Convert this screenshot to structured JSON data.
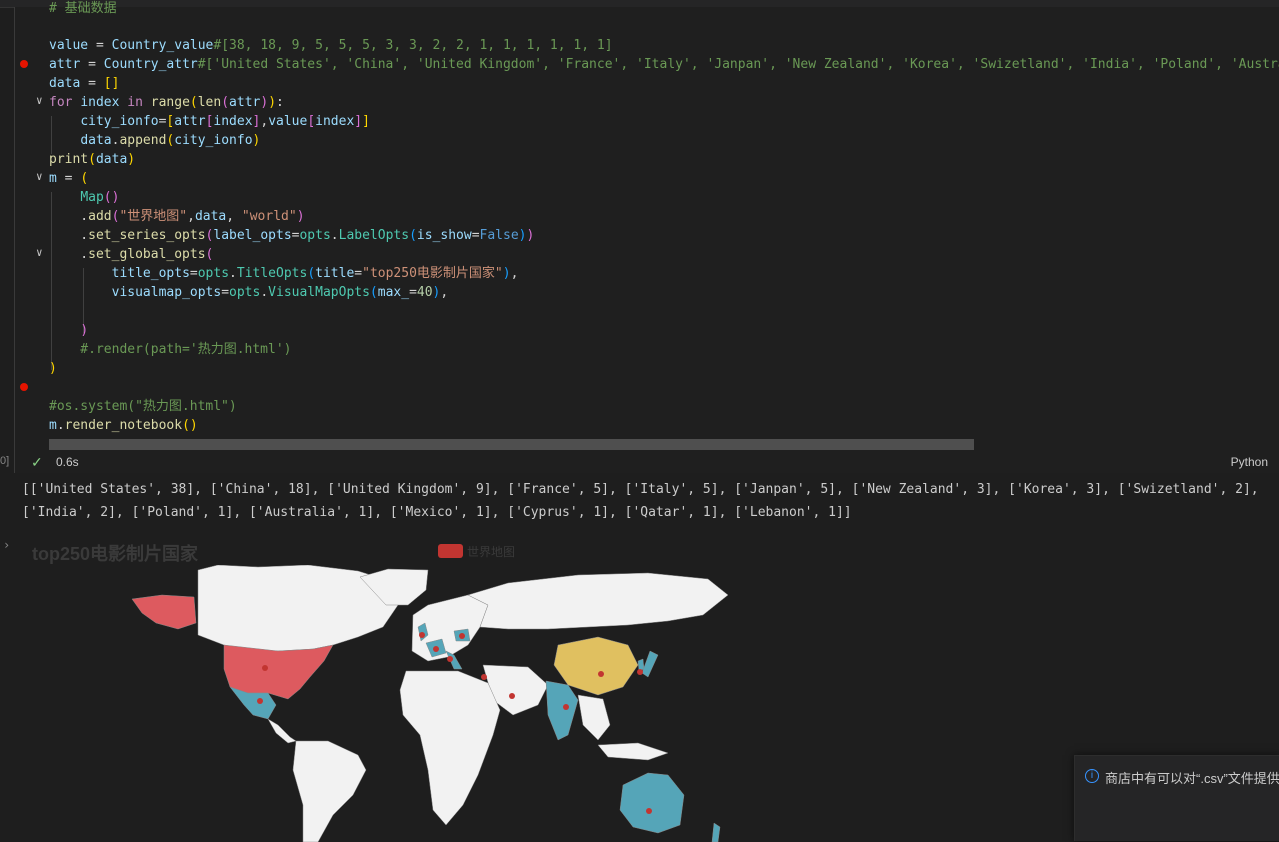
{
  "editor": {
    "code_lines": [
      "# 基础数据",
      "",
      "value = Country_value#[38, 18, 9, 5, 5, 5, 3, 3, 2, 2, 1, 1, 1, 1, 1, 1]",
      "attr = Country_attr#['United States', 'China', 'United Kingdom', 'France', 'Italy', 'Janpan', 'New Zealand', 'Korea', 'Swizetland', 'India', 'Poland', 'Austral",
      "data = []",
      "for index in range(len(attr)):",
      "    city_ionfo=[attr[index],value[index]]",
      "    data.append(city_ionfo)",
      "print(data)",
      "m = (",
      "    Map()",
      "    .add(\"世界地图\",data, \"world\")",
      "    .set_series_opts(label_opts=opts.LabelOpts(is_show=False))",
      "    .set_global_opts(",
      "        title_opts=opts.TitleOpts(title=\"top250电影制片国家\"),",
      "        visualmap_opts=opts.VisualMapOpts(max_=40),",
      "",
      "    )",
      "    #.render(path='热力图.html')",
      ")",
      "",
      "#os.system(\"热力图.html\")",
      "m.render_notebook()"
    ]
  },
  "status": {
    "check_icon": "check-icon",
    "exec_time": "0.6s",
    "language": "Python",
    "cell_index": "0]"
  },
  "output": {
    "line1": "[['United States', 38], ['China', 18], ['United Kingdom', 9], ['France', 5], ['Italy', 5], ['Janpan', 5], ['New Zealand', 3], ['Korea', 3], ['Swizetland', 2],",
    "line2": "['India', 2], ['Poland', 1], ['Australia', 1], ['Mexico', 1], ['Cyprus', 1], ['Qatar', 1], ['Lebanon', 1]]"
  },
  "chart": {
    "title": "top250电影制片国家",
    "legend_label": "世界地图",
    "colors": {
      "high": "#dd5a5f",
      "mid": "#e0c060",
      "low": "#55a5b8",
      "none": "#f2f2f2",
      "marker": "#c23531"
    }
  },
  "chart_data": {
    "type": "map",
    "map": "world",
    "series": [
      {
        "name": "世界地图",
        "data": [
          [
            "United States",
            38
          ],
          [
            "China",
            18
          ],
          [
            "United Kingdom",
            9
          ],
          [
            "France",
            5
          ],
          [
            "Italy",
            5
          ],
          [
            "Janpan",
            5
          ],
          [
            "New Zealand",
            3
          ],
          [
            "Korea",
            3
          ],
          [
            "Swizetland",
            2
          ],
          [
            "India",
            2
          ],
          [
            "Poland",
            1
          ],
          [
            "Australia",
            1
          ],
          [
            "Mexico",
            1
          ],
          [
            "Cyprus",
            1
          ],
          [
            "Qatar",
            1
          ],
          [
            "Lebanon",
            1
          ]
        ]
      }
    ],
    "visualmap_max": 40,
    "title": "top250电影制片国家"
  },
  "toast": {
    "icon": "info-icon",
    "message": "商店中有可以对“.csv”文件提供"
  }
}
